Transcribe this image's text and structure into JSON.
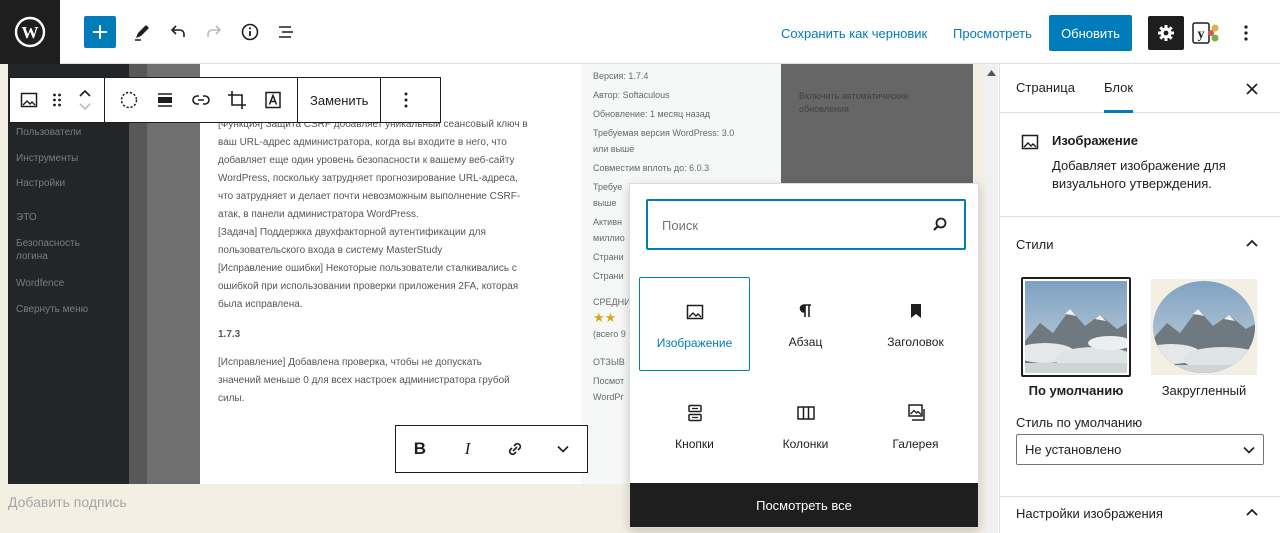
{
  "topbar": {
    "save_draft": "Сохранить как черновик",
    "preview": "Просмотреть",
    "update": "Обновить",
    "accent": "#007cba"
  },
  "block_toolbar": {
    "replace": "Заменить"
  },
  "format_toolbar": {
    "bold": "B",
    "italic": "I"
  },
  "editor": {
    "caption_placeholder": "Добавить подпись"
  },
  "screenshot": {
    "menu": [
      "Пользователи",
      "Инструменты",
      "Настройки",
      "ЭТО",
      "Безопасность",
      "логина",
      "Wordfence",
      "Свернуть меню"
    ],
    "main_lines": [
      "[Функция] Защита CSRF добавляет уникальный сеансовый ключ в",
      "ваш URL-адрес администратора, когда вы входите в него, что",
      "добавляет еще один уровень безопасности к вашему веб-сайту",
      "WordPress, поскольку затрудняет прогнозирование URL-адреса,",
      "что затрудняет и делает почти невозможным выполнение CSRF-",
      "атак, в панели администратора WordPress.",
      "[Задача] Поддержка двухфакторной аутентификации для",
      "пользовательского входа в систему MasterStudy",
      "[Исправление ошибки] Некоторые пользователи сталкивались с",
      "ошибкой при использовании проверки приложения 2FA, которая",
      "была исправлена."
    ],
    "version_heading": "1.7.3",
    "main_lines2": [
      "[Исправление] Добавлена проверка, чтобы не допускать",
      "значений меньше 0 для всех настроек администратора грубой",
      "силы."
    ],
    "side_lines": [
      "Версия: 1.7.4",
      "Автор: Softaculous",
      "Обновление: 1 месяц назад",
      "Требуемая версия WordPress: 3.0",
      "или выше",
      "Совместим вплоть до: 6.0.3",
      "Требуе",
      "выше",
      "Активн",
      "миллио",
      "Страни",
      "Страни",
      "СРЕДНИ",
      "★★",
      "(всего 9",
      "ОТЗЫВ",
      "Посмот",
      "WordPr"
    ],
    "right_text": "Включить автоматические обновления"
  },
  "inserter": {
    "search_placeholder": "Поиск",
    "blocks": [
      {
        "label": "Изображение",
        "icon": "image-icon"
      },
      {
        "label": "Абзац",
        "icon": "paragraph-icon"
      },
      {
        "label": "Заголовок",
        "icon": "bookmark-icon"
      },
      {
        "label": "Кнопки",
        "icon": "buttons-icon"
      },
      {
        "label": "Колонки",
        "icon": "columns-icon"
      },
      {
        "label": "Галерея",
        "icon": "gallery-icon"
      }
    ],
    "browse_all": "Посмотреть все"
  },
  "sidebar": {
    "tabs": [
      "Страница",
      "Блок"
    ],
    "block_card": {
      "title": "Изображение",
      "description": "Добавляет изображение для визуального утверждения."
    },
    "styles": {
      "title": "Стили",
      "options": [
        "По умолчанию",
        "Закругленный"
      ],
      "default_style_label": "Стиль по умолчанию",
      "default_style_value": "Не установлено"
    },
    "image_settings_title": "Настройки изображения"
  }
}
